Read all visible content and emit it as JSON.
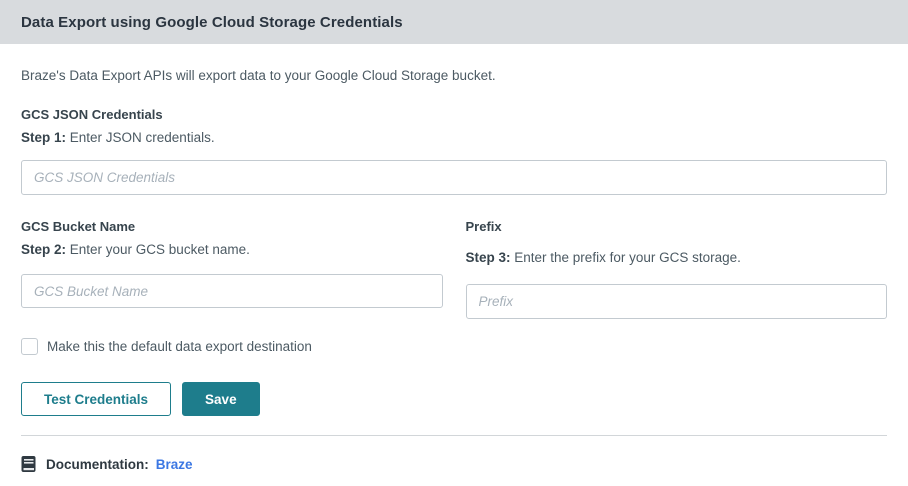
{
  "header": {
    "title": "Data Export using Google Cloud Storage Credentials"
  },
  "intro": "Braze's Data Export APIs will export data to your Google Cloud Storage bucket.",
  "credentials_section": {
    "label": "GCS JSON Credentials",
    "step_bold": "Step 1:",
    "step_text": " Enter JSON credentials.",
    "placeholder": "GCS JSON Credentials",
    "value": ""
  },
  "bucket_section": {
    "label": "GCS Bucket Name",
    "step_bold": "Step 2:",
    "step_text": " Enter your GCS bucket name.",
    "placeholder": "GCS Bucket Name",
    "value": ""
  },
  "prefix_section": {
    "label": "Prefix",
    "step_bold": "Step 3:",
    "step_text": " Enter the prefix for your GCS storage.",
    "placeholder": "Prefix",
    "value": ""
  },
  "default_checkbox": {
    "label": "Make this the default data export destination",
    "checked": false
  },
  "buttons": {
    "test_label": "Test Credentials",
    "save_label": "Save"
  },
  "footer": {
    "doc_label": "Documentation:",
    "doc_link": "Braze",
    "icon": "book-icon"
  },
  "colors": {
    "header_bg": "#d8dbde",
    "accent_teal": "#1e7d8c",
    "link_blue": "#3b77e3",
    "title_text": "#2b3540",
    "body_text": "#4c5a63",
    "input_border": "#c3cad0"
  }
}
